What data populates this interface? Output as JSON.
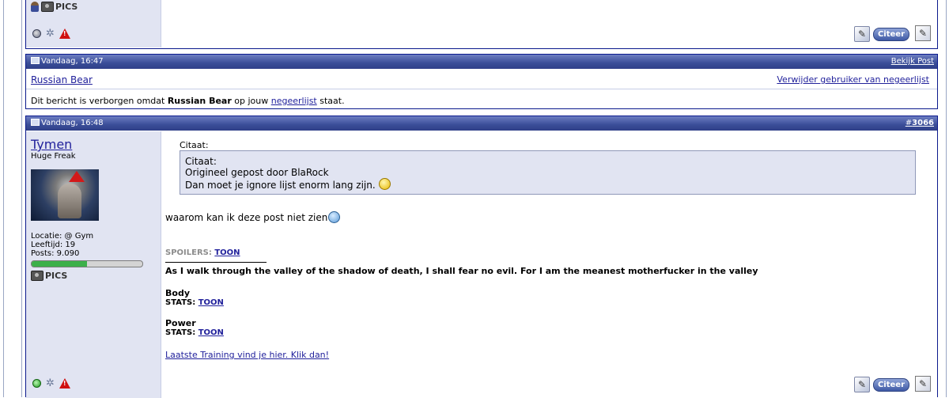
{
  "post_prev": {
    "pics_label": "PICS",
    "quote_button": "Citeer"
  },
  "post_hidden": {
    "date": "Vandaag, 16:47",
    "view_post": "Bekijk Post",
    "username": "Russian Bear",
    "remove_ignore": "Verwijder gebruiker van negeerlijst",
    "msg_before": "Dit bericht is verborgen omdat",
    "msg_user": "Russian Bear",
    "msg_middle": "op jouw",
    "msg_link": "negeerlijst",
    "msg_after": "staat."
  },
  "post_main": {
    "date": "Vandaag, 16:48",
    "post_number_prefix": "#",
    "post_number": "3066",
    "username": "Tymen",
    "user_title": "Huge Freak",
    "location": "Locatie: @ Gym",
    "age": "Leeftijd: 19",
    "posts": "Posts: 9.090",
    "reputation_fill": 0.5,
    "pics_label": "PICS",
    "quote_outer_label": "Citaat:",
    "quote_inner_label": "Citaat:",
    "quote_inner_author": "Origineel gepost door BlaRock",
    "quote_inner_text": "Dan moet je ignore lijst enorm lang zijn.",
    "message": "waarom kan ik deze post niet zien",
    "spoilers_label": "SPOILERS:",
    "spoilers_link": "TOON",
    "signature_quote": "As I walk through the valley of the shadow of death, I shall fear no evil. For I am the meanest motherfucker in the valley",
    "body_title": "Body",
    "body_stats_label": "STATS:",
    "body_stats_link": "TOON",
    "power_title": "Power",
    "power_stats_label": "STATS:",
    "power_stats_link": "TOON",
    "training_link": "Laatste Training vind je hier. Klik dan!",
    "quote_button": "Citeer"
  },
  "colors": {
    "header_bar": "#3a4d98",
    "link": "#22229c",
    "userinfo_bg": "#e1e4f2",
    "quote_bg": "#e1e4f2",
    "reputation": "#3cb04a"
  }
}
